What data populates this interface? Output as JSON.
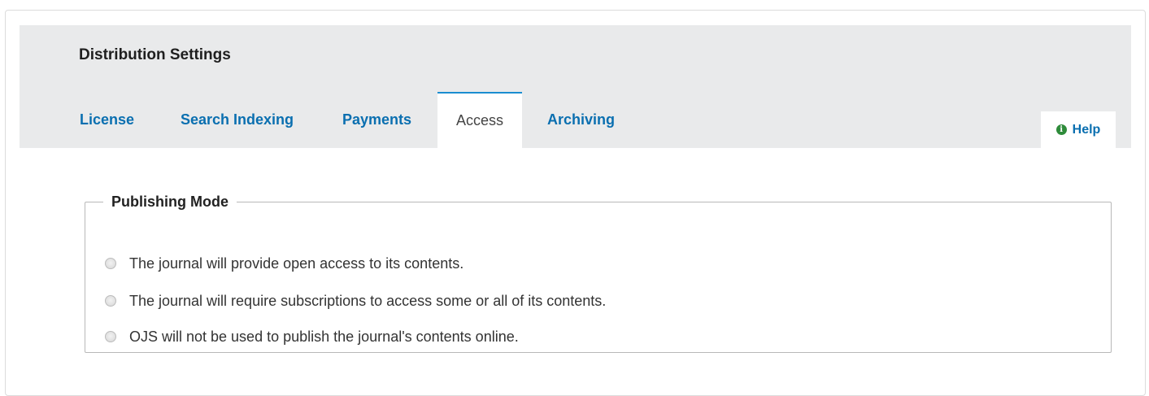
{
  "page": {
    "title": "Distribution Settings"
  },
  "tabs": [
    {
      "label": "License"
    },
    {
      "label": "Search Indexing"
    },
    {
      "label": "Payments"
    },
    {
      "label": "Access",
      "active": true
    },
    {
      "label": "Archiving"
    }
  ],
  "help": {
    "label": "Help",
    "icon": "info-icon"
  },
  "publishing_mode": {
    "legend": "Publishing Mode",
    "options": [
      {
        "label": "The journal will provide open access to its contents.",
        "checked": false
      },
      {
        "label": "The journal will require subscriptions to access some or all of its contents.",
        "checked": false
      },
      {
        "label": "OJS will not be used to publish the journal's contents online.",
        "checked": false
      }
    ]
  },
  "colors": {
    "link": "#0a6fb0",
    "tab_active_border": "#1a8dd0",
    "panel_bg": "#e9eaeb",
    "help_icon": "#2e8b3a"
  }
}
